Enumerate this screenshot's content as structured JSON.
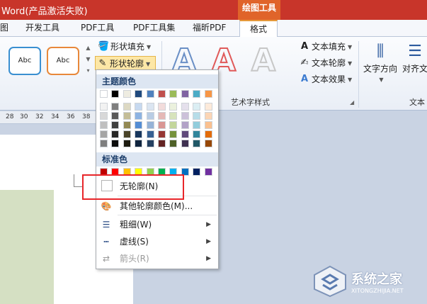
{
  "titlebar": {
    "title": "Word(产品激活失败)",
    "context_header": "绘图工具"
  },
  "tabs": [
    {
      "label": "图"
    },
    {
      "label": "开发工具"
    },
    {
      "label": "PDF工具"
    },
    {
      "label": "PDF工具集"
    },
    {
      "label": "福昕PDF"
    },
    {
      "label": "格式"
    }
  ],
  "ribbon": {
    "shape_style_sample": "Abc",
    "shape_fill": "形状填充",
    "shape_outline": "形状轮廓",
    "wordart_letter": "A",
    "text_fill": "文本填充",
    "text_outline": "文本轮廓",
    "text_effects": "文本效果",
    "wordart_group_label": "艺术字样式",
    "text_direction": "文字方向",
    "align_text": "对齐文",
    "text_group_label": "文本"
  },
  "ruler": {
    "ticks": [
      "28",
      "30",
      "32",
      "34",
      "36",
      "38"
    ]
  },
  "outline_menu": {
    "theme_heading": "主题颜色",
    "theme_colors": [
      "#ffffff",
      "#000000",
      "#eeece1",
      "#1f497d",
      "#4f81bd",
      "#c0504d",
      "#9bbb59",
      "#8064a2",
      "#4bacc6",
      "#f79646"
    ],
    "theme_shade_columns": [
      [
        "#f2f2f2",
        "#d8d8d8",
        "#bfbfbf",
        "#a5a5a5",
        "#7f7f7f"
      ],
      [
        "#7f7f7f",
        "#595959",
        "#3f3f3f",
        "#262626",
        "#0c0c0c"
      ],
      [
        "#ddd9c3",
        "#c4bd97",
        "#938953",
        "#494429",
        "#1d1b10"
      ],
      [
        "#c6d9f0",
        "#8db3e2",
        "#548dd4",
        "#17365d",
        "#0f243e"
      ],
      [
        "#dbe5f1",
        "#b8cce4",
        "#95b3d7",
        "#366092",
        "#244061"
      ],
      [
        "#f2dcdb",
        "#e5b9b7",
        "#d99694",
        "#953734",
        "#632423"
      ],
      [
        "#ebf1dd",
        "#d7e3bc",
        "#c3d69b",
        "#76923c",
        "#4f6128"
      ],
      [
        "#e5e0ec",
        "#ccc1d9",
        "#b2a2c7",
        "#5f497a",
        "#3f3151"
      ],
      [
        "#dbeef3",
        "#b7dde8",
        "#92cddc",
        "#31859b",
        "#205867"
      ],
      [
        "#fdeada",
        "#fbd5b5",
        "#fac08f",
        "#e36c09",
        "#974806"
      ]
    ],
    "standard_heading": "标准色",
    "standard_colors": [
      "#c00000",
      "#ff0000",
      "#ffc000",
      "#ffff00",
      "#92d050",
      "#00b050",
      "#00b0f0",
      "#0070c0",
      "#002060",
      "#7030a0"
    ],
    "no_outline": "无轮廓(N)",
    "more_colors": "其他轮廓颜色(M)...",
    "weight": "粗细(W)",
    "dashes": "虚线(S)",
    "arrows": "箭头(R)"
  },
  "watermark": {
    "title": "系统之家",
    "url": "XITONGZHIJIA.NET"
  }
}
